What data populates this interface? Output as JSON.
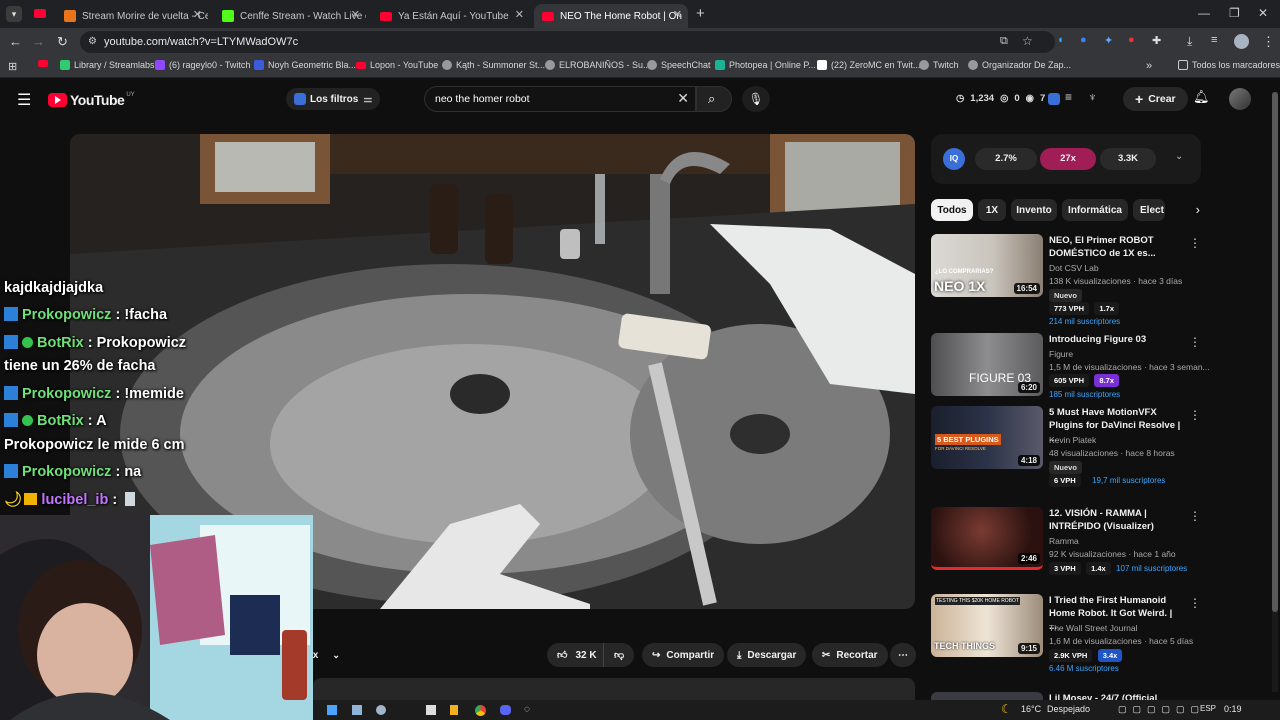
{
  "browser": {
    "tabs": [
      {
        "title": "Stream Morire de vuelta - Cenffe",
        "color": "#e53935"
      },
      {
        "title": "Cenffe Stream - Watch Live on",
        "color": "#53fc18"
      },
      {
        "title": "Ya Están Aquí - YouTube",
        "color": "#ff0033"
      },
      {
        "title": "NEO The Home Robot | On",
        "color": "#ff0033"
      }
    ],
    "url": "youtube.com/watch?v=LTYMWadOW7c",
    "bookmarks": [
      "Library / Streamlabs",
      "(6) rageylo0 - Twitch",
      "Noyh Geometric Bla...",
      "Lopon - YouTube",
      "Kąth - Summoner St...",
      "ELROBANIÑOS - Su...",
      "SpeechChat",
      "Photopea | Online P...",
      "(22) ZeroMC en Twit...",
      "Twitch",
      "Organizador De Zap..."
    ],
    "all_bookmarks": "Todos los marcadores"
  },
  "youtube": {
    "logo_text": "YouTube",
    "logo_suffix": "UY",
    "filters_label": "Los filtros",
    "search_value": "neo the homer robot",
    "stats": {
      "views": "1,234",
      "a": "0",
      "b": "7"
    },
    "create_label": "Crear",
    "ext_bar": {
      "a": "2.7%",
      "b": "27x",
      "c": "3.3K"
    },
    "chips": [
      "Todos",
      "1X",
      "Invento",
      "Informática",
      "Elect"
    ],
    "actions": {
      "likes": "32 K",
      "share": "Compartir",
      "download": "Descargar",
      "clip": "Recortar",
      "remix_partial": "ix"
    },
    "related": [
      {
        "title": "NEO, El Primer ROBOT DOMÉSTICO de 1X es...",
        "channel": "Dot CSV Lab",
        "meta": "138 K visualizaciones · hace 3 días",
        "duration": "16:54",
        "thumb_text": "NEO 1X",
        "thumb_top": "¿LO COMPRARIAS?",
        "new": "Nuevo",
        "vph": "773 VPH",
        "mult": "1.7x",
        "subs": "214 mil suscriptores"
      },
      {
        "title": "Introducing Figure 03",
        "channel": "Figure",
        "meta": "1,5 M de visualizaciones · hace 3 seman...",
        "duration": "6:20",
        "thumb_text": "FIGURE 03",
        "vph": "605 VPH",
        "mult": "8.7x",
        "subs": "185 mil suscriptores"
      },
      {
        "title": "5 Must Have MotionVFX Plugins for DaVinci Resolve | ...",
        "channel": "Kevin Piatek",
        "meta": "48 visualizaciones · hace 8 horas",
        "duration": "4:18",
        "thumb_text": "5 BEST PLUGINS",
        "thumb_sub": "FOR DAVINCI RESOLVE",
        "new": "Nuevo",
        "vph": "6 VPH",
        "subs": "19,7 mil suscriptores"
      },
      {
        "title": "12. VISIÓN - RAMMA | INTRÉPIDO (Visualizer)",
        "channel": "Ramma",
        "meta": "92 K visualizaciones · hace 1 año",
        "duration": "2:46",
        "vph": "3 VPH",
        "mult": "1.4x",
        "subs": "107 mil suscriptores"
      },
      {
        "title": "I Tried the First Humanoid Home Robot. It Got Weird. | ...",
        "channel": "The Wall Street Journal",
        "meta": "1,6 M de visualizaciones · hace 5 días",
        "duration": "9:15",
        "thumb_text": "TECH THINGS",
        "thumb_top": "TESTING THIS $20K HOME ROBOT",
        "vph": "2.9K VPH",
        "mult": "3.4x",
        "subs": "6.46 M suscriptores"
      },
      {
        "title": "Lil Mosey - 24/7 (Official Music..."
      }
    ]
  },
  "chat": [
    {
      "user": "",
      "text": "kajdkajdjajdka"
    },
    {
      "user": "Prokopowicz",
      "text": ": !facha"
    },
    {
      "user": "BotRix",
      "text": ": Prokopowicz"
    },
    {
      "user": "",
      "text": "tiene un 26% de facha"
    },
    {
      "user": "Prokopowicz",
      "text": ": !memide"
    },
    {
      "user": "BotRix",
      "text": ": A"
    },
    {
      "user": "",
      "text": "Prokopowicz le mide 6 cm"
    },
    {
      "user": "Prokopowicz",
      "text": ": na"
    },
    {
      "user": "lucibel_ib",
      "text": ":"
    }
  ],
  "taskbar": {
    "weather": "16°C",
    "weather_desc": "Despejado",
    "lang": "ESP",
    "time": "0:19"
  }
}
